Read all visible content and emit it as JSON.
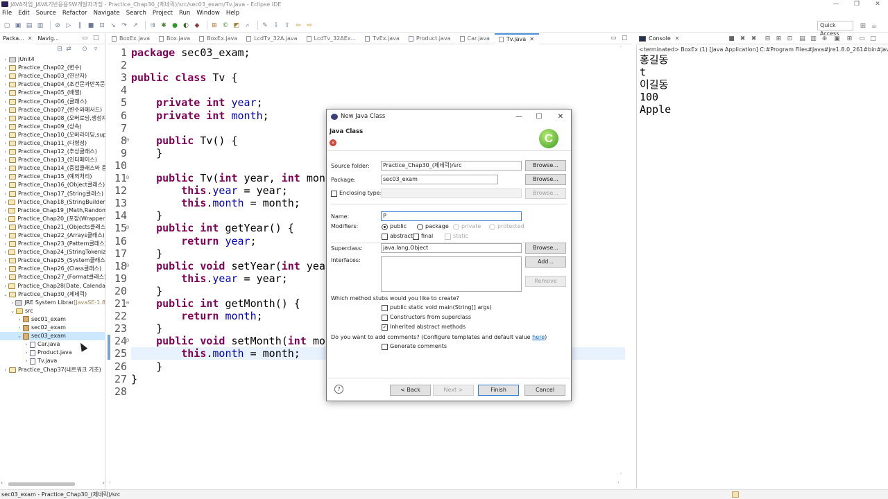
{
  "window": {
    "title": "JAVA작업_JAVA기반응용SW개발자과정 - Practice_Chap30_(제네릭)/src/sec03_exam/Tv.java - Eclipse IDE",
    "minimize": "—",
    "maximize": "❐",
    "close": "✕"
  },
  "menu": [
    "File",
    "Edit",
    "Source",
    "Refactor",
    "Navigate",
    "Search",
    "Project",
    "Run",
    "Window",
    "Help"
  ],
  "toolbar": {
    "quick_access": "Quick Access"
  },
  "explorer": {
    "tabs": [
      {
        "label": "Packa..."
      },
      {
        "label": "Navig..."
      }
    ],
    "tree": [
      {
        "label": "JUnit4",
        "depth": 0,
        "arrow": ">",
        "icon": "jar"
      },
      {
        "label": "Practice_Chap02_(변수)",
        "depth": 0,
        "arrow": ">",
        "icon": "folder"
      },
      {
        "label": "Practice_Chap03_(연산자)",
        "depth": 0,
        "arrow": ">",
        "icon": "folder"
      },
      {
        "label": "Practice_Chap04_(조건문과반복문",
        "depth": 0,
        "arrow": ">",
        "icon": "folder"
      },
      {
        "label": "Practice_Chap05_(배열)",
        "depth": 0,
        "arrow": ">",
        "icon": "folder"
      },
      {
        "label": "Practice_Chap06_(클래스)",
        "depth": 0,
        "arrow": ">",
        "icon": "folder"
      },
      {
        "label": "Practice_Chap07_(변수와메서드)",
        "depth": 0,
        "arrow": ">",
        "icon": "folder"
      },
      {
        "label": "Practice_Chap08_(오버로딩,생성자",
        "depth": 0,
        "arrow": ">",
        "icon": "folder"
      },
      {
        "label": "Practice_Chap09_(상속)",
        "depth": 0,
        "arrow": ">",
        "icon": "folder"
      },
      {
        "label": "Practice_Chap10_(오버라이딩,sup",
        "depth": 0,
        "arrow": ">",
        "icon": "folder"
      },
      {
        "label": "Practice_Chap11_(다형성)",
        "depth": 0,
        "arrow": ">",
        "icon": "folder"
      },
      {
        "label": "Practice_Chap12_(추상클래스)",
        "depth": 0,
        "arrow": ">",
        "icon": "folder"
      },
      {
        "label": "Practice_Chap13_(인터페이스)",
        "depth": 0,
        "arrow": ">",
        "icon": "folder"
      },
      {
        "label": "Practice_Chap14_(중첩클래스와 중",
        "depth": 0,
        "arrow": ">",
        "icon": "folder"
      },
      {
        "label": "Practice_Chap15_(예외처리)",
        "depth": 0,
        "arrow": ">",
        "icon": "folder"
      },
      {
        "label": "Practice_Chap16_(Object클래스)",
        "depth": 0,
        "arrow": ">",
        "icon": "folder"
      },
      {
        "label": "Practice_Chap17_(String클래스)",
        "depth": 0,
        "arrow": ">",
        "icon": "folder"
      },
      {
        "label": "Practice_Chap18_(StringBuilder클",
        "depth": 0,
        "arrow": ">",
        "icon": "folder"
      },
      {
        "label": "Practice_Chap19_(Math,Random를",
        "depth": 0,
        "arrow": ">",
        "icon": "folder"
      },
      {
        "label": "Practice_Chap20_(포장(Wrapper)를",
        "depth": 0,
        "arrow": ">",
        "icon": "folder"
      },
      {
        "label": "Practice_Chap21_(Objects클래스)",
        "depth": 0,
        "arrow": ">",
        "icon": "folder"
      },
      {
        "label": "Practice_Chap22_(Arrays클래스)",
        "depth": 0,
        "arrow": ">",
        "icon": "folder"
      },
      {
        "label": "Practice_Chap23_(Pattern클래스)",
        "depth": 0,
        "arrow": ">",
        "icon": "folder"
      },
      {
        "label": "Practice_Chap24_(StringTokenizer",
        "depth": 0,
        "arrow": ">",
        "icon": "folder"
      },
      {
        "label": "Practice_Chap25_(System클래스)",
        "depth": 0,
        "arrow": ">",
        "icon": "folder"
      },
      {
        "label": "Practice_Chap26_(Class클래스)",
        "depth": 0,
        "arrow": ">",
        "icon": "folder"
      },
      {
        "label": "Practice_Chap27_(Format클래스)",
        "depth": 0,
        "arrow": ">",
        "icon": "folder"
      },
      {
        "label": "Practice_Chap28(Date, Calendar를",
        "depth": 0,
        "arrow": ">",
        "icon": "folder"
      },
      {
        "label": "Practice_Chap30_(제네릭)",
        "depth": 0,
        "arrow": "v",
        "icon": "folder"
      },
      {
        "label": "JRE System Library",
        "suffix": " [JavaSE-1.8",
        "depth": 1,
        "arrow": ">",
        "icon": "jar"
      },
      {
        "label": "src",
        "depth": 1,
        "arrow": "v",
        "icon": "src"
      },
      {
        "label": "sec01_exam",
        "depth": 2,
        "arrow": ">",
        "icon": "pkg"
      },
      {
        "label": "sec02_exam",
        "depth": 2,
        "arrow": ">",
        "icon": "pkg"
      },
      {
        "label": "sec03_exam",
        "depth": 2,
        "arrow": "v",
        "icon": "pkg",
        "selected": true
      },
      {
        "label": "Car.java",
        "depth": 3,
        "arrow": ">",
        "icon": "java"
      },
      {
        "label": "Product.java",
        "depth": 3,
        "arrow": ">",
        "icon": "java"
      },
      {
        "label": "Tv.java",
        "depth": 3,
        "arrow": ">",
        "icon": "java"
      },
      {
        "label": "Practice_Chap37(네트워크 기초)",
        "depth": 0,
        "arrow": ">",
        "icon": "folder"
      }
    ]
  },
  "editor": {
    "tabs": [
      {
        "label": "BoxEx.java"
      },
      {
        "label": "Box.java"
      },
      {
        "label": "BoxEx.java"
      },
      {
        "label": "LcdTv_32A.java"
      },
      {
        "label": "LcdTv_32AEx..."
      },
      {
        "label": "TvEx.java"
      },
      {
        "label": "Product.java"
      },
      {
        "label": "Car.java"
      },
      {
        "label": "Tv.java",
        "active": true
      }
    ],
    "lines": [
      "package sec03_exam;",
      "",
      "public class Tv {",
      "",
      "    private int year;",
      "    private int month;",
      "",
      "    public Tv() {",
      "    }",
      "",
      "    public Tv(int year, int month",
      "        this.year = year;",
      "        this.month = month;",
      "    }",
      "    public int getYear() {",
      "        return year;",
      "    }",
      "    public void setYear(int year",
      "        this.year = year;",
      "    }",
      "    public int getMonth() {",
      "        return month;",
      "    }",
      "    public void setMonth(int mont",
      "        this.month = month;",
      "    }",
      "}",
      ""
    ],
    "highlighted_line": 25
  },
  "console": {
    "tab_label": "Console",
    "terminated": "<terminated> BoxEx (1) [Java Application] C:#Program Files#Java#jre1.8.0_261#bin#javaw.exe (20",
    "output": [
      "홍길동",
      "t",
      "이길동",
      "100",
      "Apple"
    ]
  },
  "statusbar": {
    "text": "sec03_exam - Practice_Chap30_(제네릭)/src"
  },
  "dialog": {
    "title": "New Java Class",
    "header_title": "Java Class",
    "source_folder_label": "Source folder:",
    "source_folder_value": "Practice_Chap30_(제네릭)/src",
    "package_label": "Package:",
    "package_value": "sec03_exam",
    "enclosing_label": "Enclosing type:",
    "enclosing_value": "",
    "name_label": "Name:",
    "name_value": "P",
    "modifiers_label": "Modifiers:",
    "mod_public": "public",
    "mod_package": "package",
    "mod_private": "private",
    "mod_protected": "protected",
    "mod_abstract": "abstract",
    "mod_final": "final",
    "mod_static": "static",
    "superclass_label": "Superclass:",
    "superclass_value": "java.lang.Object",
    "interfaces_label": "Interfaces:",
    "browse": "Browse...",
    "add": "Add...",
    "remove": "Remove",
    "stubs_question": "Which method stubs would you like to create?",
    "stub_main": "public static void main(String[] args)",
    "stub_constructors": "Constructors from superclass",
    "stub_inherited": "Inherited abstract methods",
    "comments_question": "Do you want to add comments? (Configure templates and default value ",
    "comments_link": "here",
    "comments_close": ")",
    "generate_comments": "Generate comments",
    "back": "< Back",
    "next": "Next >",
    "finish": "Finish",
    "cancel": "Cancel",
    "help": "?",
    "checkmark": "✓"
  }
}
